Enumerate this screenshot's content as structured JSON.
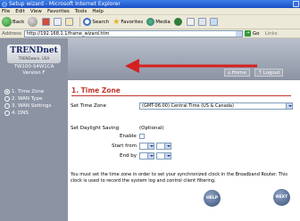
{
  "window": {
    "title": "Setup wizard - Microsoft Internet Explorer"
  },
  "menu": {
    "items": [
      "File",
      "Edit",
      "View",
      "Favorites",
      "Tools",
      "Help"
    ]
  },
  "toolbar": {
    "back_label": "Back",
    "search_label": "Search",
    "favorites_label": "Favorites",
    "media_label": "Media"
  },
  "address": {
    "label": "Address",
    "url": "http://192.168.1.1/frame_wizard.htm",
    "go_label": "Go",
    "links_label": "Links"
  },
  "sidebar": {
    "logo": "TRENDnet",
    "logo_sub": "TRENDware, USA",
    "model_line1": "TW100-S4W1CA",
    "model_line2": "Version F",
    "steps": [
      {
        "label": "1. Time Zone",
        "active": true
      },
      {
        "label": "2. WAN Type",
        "active": false
      },
      {
        "label": "3. WAN Settings",
        "active": false
      },
      {
        "label": "4. DNS",
        "active": false
      }
    ]
  },
  "nav": {
    "home_label": "Home",
    "logout_label": "Logout"
  },
  "main": {
    "title": "1. Time Zone",
    "time_zone_label": "Set Time Zone",
    "time_zone_value": "(GMT-06:00) Central Time (US & Canada)",
    "daylight_label": "Set Daylight Saving",
    "optional_label": "(Optional)",
    "enable_label": "Enable",
    "start_label": "Start from",
    "end_label": "End by",
    "note": "You must set the time zone in order to set your synchronized clock in the Broadband Router. This clock is used to record the system log and control client filtering.",
    "help_label": "HELP",
    "next_label": "NEXT"
  },
  "colors": {
    "accent": "#c0392b",
    "sidebar": "#8c94a4",
    "titlebar": "#2a5fd4"
  }
}
